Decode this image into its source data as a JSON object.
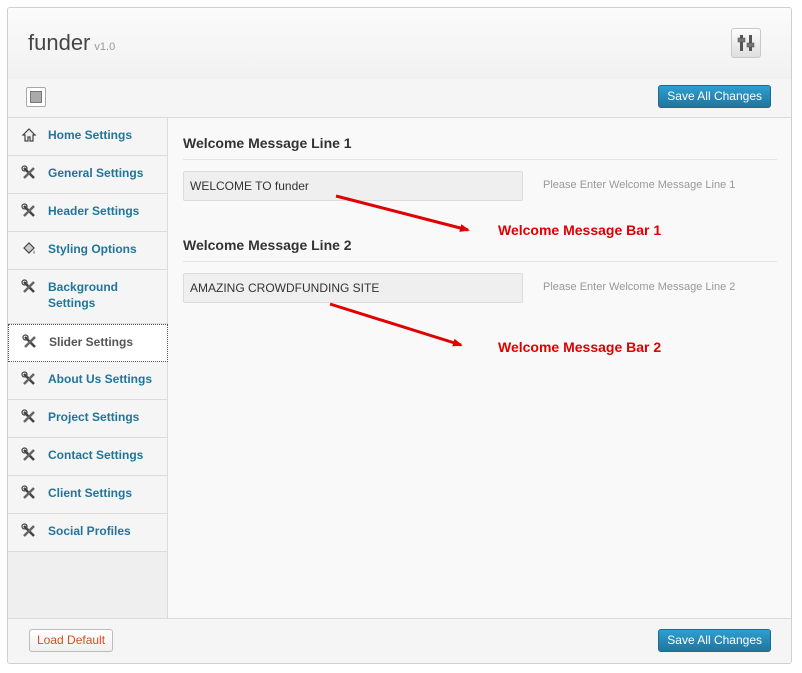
{
  "header": {
    "app_name": "funder",
    "version": "v1.0"
  },
  "toolbar": {
    "save_label": "Save All Changes"
  },
  "sidebar": {
    "items": [
      {
        "label": "Home Settings",
        "icon": "home-icon"
      },
      {
        "label": "General Settings",
        "icon": "tools-icon"
      },
      {
        "label": "Header Settings",
        "icon": "tools-icon"
      },
      {
        "label": "Styling Options",
        "icon": "paint-bucket-icon"
      },
      {
        "label": "Background Settings",
        "icon": "tools-icon"
      },
      {
        "label": "Slider Settings",
        "icon": "tools-icon",
        "active": true
      },
      {
        "label": "About Us Settings",
        "icon": "tools-icon"
      },
      {
        "label": "Project Settings",
        "icon": "tools-icon"
      },
      {
        "label": "Contact Settings",
        "icon": "tools-icon"
      },
      {
        "label": "Client Settings",
        "icon": "tools-icon"
      },
      {
        "label": "Social Profiles",
        "icon": "tools-icon"
      }
    ]
  },
  "main": {
    "fields": [
      {
        "title": "Welcome Message Line 1",
        "value": "WELCOME TO funder",
        "help": "Please Enter Welcome Message Line 1"
      },
      {
        "title": "Welcome Message Line 2",
        "value": "AMAZING CROWDFUNDING SITE",
        "help": "Please Enter Welcome Message Line 2"
      }
    ],
    "annotations": [
      "Welcome Message Bar 1",
      "Welcome Message Bar 2"
    ]
  },
  "footer": {
    "load_default_label": "Load Default",
    "save_label": "Save All Changes"
  },
  "colors": {
    "accent": "#21759b",
    "annotation": "#e00000",
    "link": "#d54e21"
  }
}
